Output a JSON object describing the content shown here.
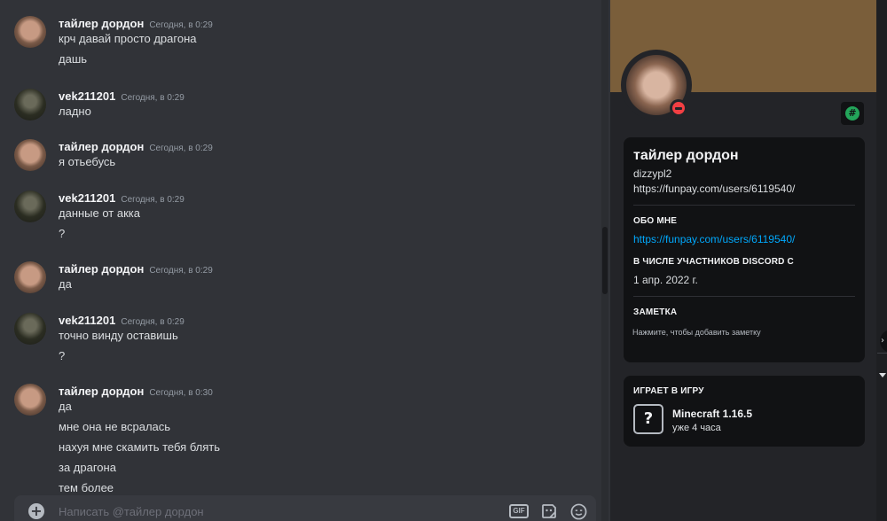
{
  "chat": {
    "messages": [
      {
        "author": "тайлер дордон",
        "time": "Сегодня, в 0:29",
        "avatar": "user1",
        "lines": [
          "крч давай просто драгона",
          "дашь"
        ]
      },
      {
        "author": "vek211201",
        "time": "Сегодня, в 0:29",
        "avatar": "user2",
        "lines": [
          "ладно"
        ]
      },
      {
        "author": "тайлер дордон",
        "time": "Сегодня, в 0:29",
        "avatar": "user1",
        "lines": [
          "я отьебусь"
        ]
      },
      {
        "author": "vek211201",
        "time": "Сегодня, в 0:29",
        "avatar": "user2",
        "lines": [
          "данные от акка",
          "?"
        ]
      },
      {
        "author": "тайлер дордон",
        "time": "Сегодня, в 0:29",
        "avatar": "user1",
        "lines": [
          "да"
        ]
      },
      {
        "author": "vek211201",
        "time": "Сегодня, в 0:29",
        "avatar": "user2",
        "lines": [
          "точно винду оставишь",
          "?"
        ]
      },
      {
        "author": "тайлер дордон",
        "time": "Сегодня, в 0:30",
        "avatar": "user1",
        "lines": [
          "да",
          "мне она не всралась",
          "нахуя мне скамить тебя блять",
          "за драгона",
          "тем более"
        ]
      }
    ]
  },
  "composer": {
    "placeholder": "Написать @тайлер дордон",
    "gif_label": "GIF",
    "add_icon": "plus-circle-icon",
    "sticker_icon": "sticker-icon",
    "emoji_icon": "emoji-icon"
  },
  "profile": {
    "display_name": "тайлер дордон",
    "username": "dizzypl2",
    "pronouns": "https://funpay.com/users/6119540/",
    "about_heading": "ОБО МНЕ",
    "about_link": "https://funpay.com/users/6119540/",
    "member_since_heading": "В ЧИСЛЕ УЧАСТНИКОВ DISCORD С",
    "member_since_value": "1 апр. 2022 г.",
    "note_heading": "ЗАМЕТКА",
    "note_placeholder": "Нажмите, чтобы добавить заметку",
    "status": "dnd",
    "badge_icon": "nitro-badge-icon",
    "banner_color": "#7a5e3a",
    "activity": {
      "heading": "ИГРАЕТ В ИГРУ",
      "game": "Minecraft 1.16.5",
      "elapsed": "уже 4 часа",
      "icon": "unknown-game-icon"
    }
  },
  "colors": {
    "chat_bg": "#313338",
    "panel_bg": "#232428",
    "card_bg": "#111214",
    "link": "#00a8fc",
    "dnd": "#f23f43"
  }
}
